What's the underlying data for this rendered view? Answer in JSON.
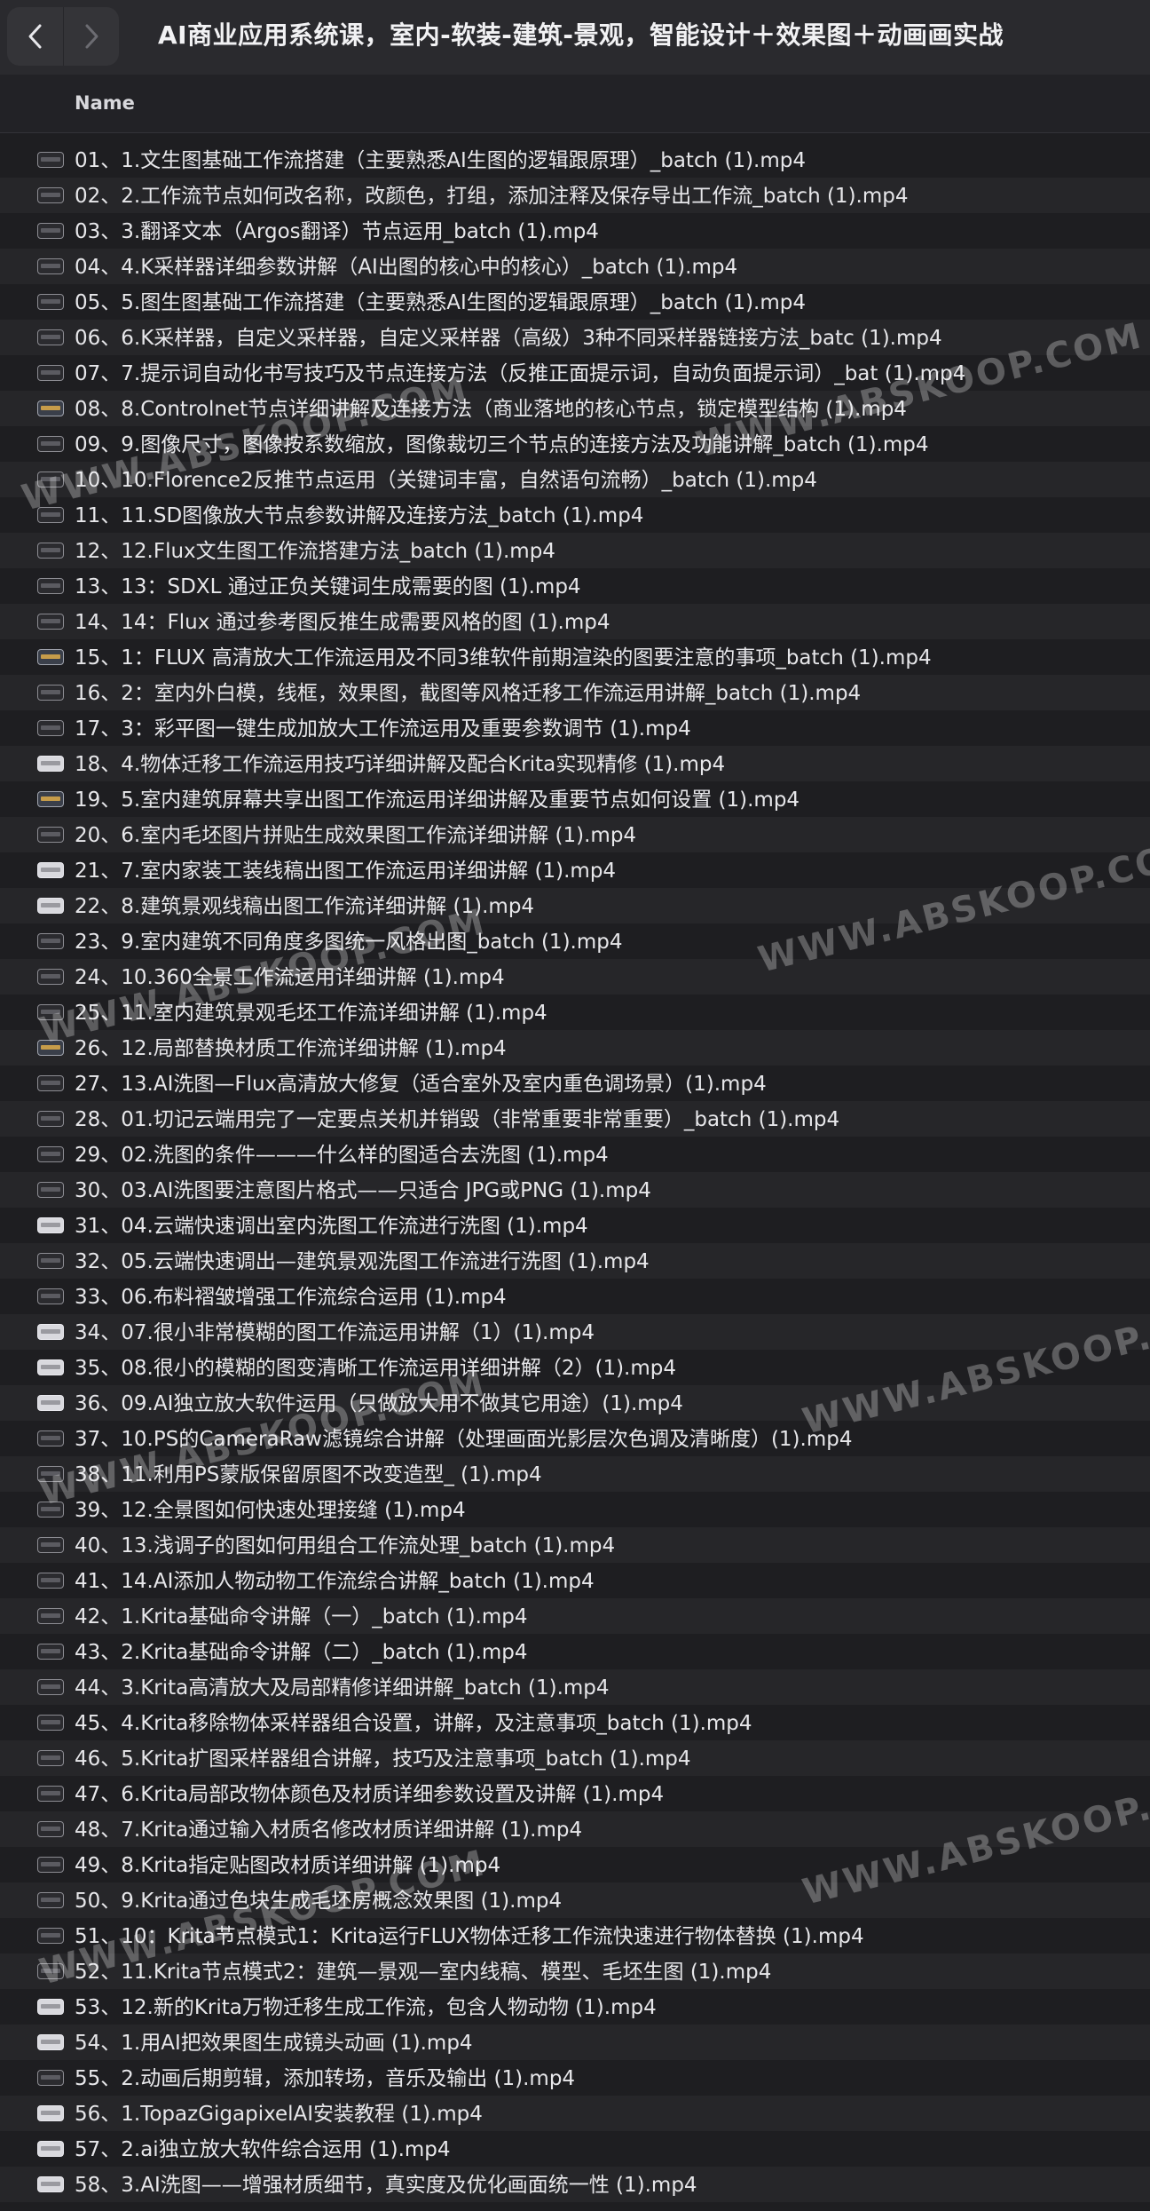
{
  "window": {
    "title": "AI商业应用系统课，室内-软装-建筑-景观，智能设计＋效果图＋动画画实战"
  },
  "columns": {
    "name_label": "Name"
  },
  "watermark": {
    "text": "WWW.ABSKOOP.COM"
  },
  "files": [
    "01、1.文生图基础工作流搭建（主要熟悉AI生图的逻辑跟原理）_batch (1).mp4",
    "02、2.工作流节点如何改名称，改颜色，打组，添加注释及保存导出工作流_batch (1).mp4",
    "03、3.翻译文本（Argos翻译）节点运用_batch (1).mp4",
    "04、4.K采样器详细参数讲解（AI出图的核心中的核心）_batch (1).mp4",
    "05、5.图生图基础工作流搭建（主要熟悉AI生图的逻辑跟原理）_batch (1).mp4",
    "06、6.K采样器，自定义采样器，自定义采样器（高级）3种不同采样器链接方法_batc (1).mp4",
    "07、7.提示词自动化书写技巧及节点连接方法（反推正面提示词，自动负面提示词）_bat (1).mp4",
    "08、8.Controlnet节点详细讲解及连接方法（商业落地的核心节点，锁定模型结构 (1).mp4",
    "09、9.图像尺寸，图像按系数缩放，图像裁切三个节点的连接方法及功能讲解_batch (1).mp4",
    "10、10.Florence2反推节点运用（关键词丰富，自然语句流畅）_batch (1).mp4",
    "11、11.SD图像放大节点参数讲解及连接方法_batch (1).mp4",
    "12、12.Flux文生图工作流搭建方法_batch (1).mp4",
    "13、13：SDXL 通过正负关键词生成需要的图 (1).mp4",
    "14、14：Flux 通过参考图反推生成需要风格的图 (1).mp4",
    "15、1：FLUX 高清放大工作流运用及不同3维软件前期渲染的图要注意的事项_batch (1).mp4",
    "16、2：室内外白模，线框，效果图，截图等风格迁移工作流运用讲解_batch (1).mp4",
    "17、3：彩平图一键生成加放大工作流运用及重要参数调节 (1).mp4",
    "18、4.物体迁移工作流运用技巧详细讲解及配合Krita实现精修 (1).mp4",
    "19、5.室内建筑屏幕共享出图工作流运用详细讲解及重要节点如何设置 (1).mp4",
    "20、6.室内毛坯图片拼贴生成效果图工作流详细讲解 (1).mp4",
    "21、7.室内家装工装线稿出图工作流运用详细讲解 (1).mp4",
    "22、8.建筑景观线稿出图工作流详细讲解 (1).mp4",
    "23、9.室内建筑不同角度多图统一风格出图_batch (1).mp4",
    "24、10.360全景工作流运用详细讲解 (1).mp4",
    "25、11.室内建筑景观毛坯工作流详细讲解 (1).mp4",
    "26、12.局部替换材质工作流详细讲解 (1).mp4",
    "27、13.AI洗图—Flux高清放大修复（适合室外及室内重色调场景）(1).mp4",
    "28、01.切记云端用完了一定要点关机并销毁（非常重要非常重要）_batch (1).mp4",
    "29、02.洗图的条件———什么样的图适合去洗图 (1).mp4",
    "30、03.AI洗图要注意图片格式——只适合 JPG或PNG (1).mp4",
    "31、04.云端快速调出室内洗图工作流进行洗图 (1).mp4",
    "32、05.云端快速调出—建筑景观洗图工作流进行洗图 (1).mp4",
    "33、06.布料褶皱增强工作流综合运用 (1).mp4",
    "34、07.很小非常模糊的图工作流运用讲解（1）(1).mp4",
    "35、08.很小的模糊的图变清晰工作流运用详细讲解（2）(1).mp4",
    "36、09.AI独立放大软件运用（只做放大用不做其它用途）(1).mp4",
    "37、10.PS的CameraRaw滤镜综合讲解（处理画面光影层次色调及清晰度）(1).mp4",
    "38、11.利用PS蒙版保留原图不改变造型_ (1).mp4",
    "39、12.全景图如何快速处理接缝 (1).mp4",
    "40、13.浅调子的图如何用组合工作流处理_batch (1).mp4",
    "41、14.AI添加人物动物工作流综合讲解_batch (1).mp4",
    "42、1.Krita基础命令讲解（一）_batch (1).mp4",
    "43、2.Krita基础命令讲解（二）_batch (1).mp4",
    "44、3.Krita高清放大及局部精修详细讲解_batch (1).mp4",
    "45、4.Krita移除物体采样器组合设置，讲解，及注意事项_batch (1).mp4",
    "46、5.Krita扩图采样器组合讲解，技巧及注意事项_batch (1).mp4",
    "47、6.Krita局部改物体颜色及材质详细参数设置及讲解 (1).mp4",
    "48、7.Krita通过输入材质名修改材质详细讲解 (1).mp4",
    "49、8.Krita指定贴图改材质详细讲解 (1).mp4",
    "50、9.Krita通过色块生成毛坯房概念效果图 (1).mp4",
    "51、10：Krita节点模式1：Krita运行FLUX物体迁移工作流快速进行物体替换 (1).mp4",
    "52、11.Krita节点模式2：建筑—景观—室内线稿、模型、毛坯生图 (1).mp4",
    "53、12.新的Krita万物迁移生成工作流，包含人物动物 (1).mp4",
    "54、1.用AI把效果图生成镜头动画 (1).mp4",
    "55、2.动画后期剪辑，添加转场，音乐及输出 (1).mp4",
    "56、1.TopazGigapixelAI安装教程 (1).mp4",
    "57、2.ai独立放大软件综合运用 (1).mp4",
    "58、3.AI洗图——增强材质细节，真实度及优化画面统一性 (1).mp4"
  ]
}
